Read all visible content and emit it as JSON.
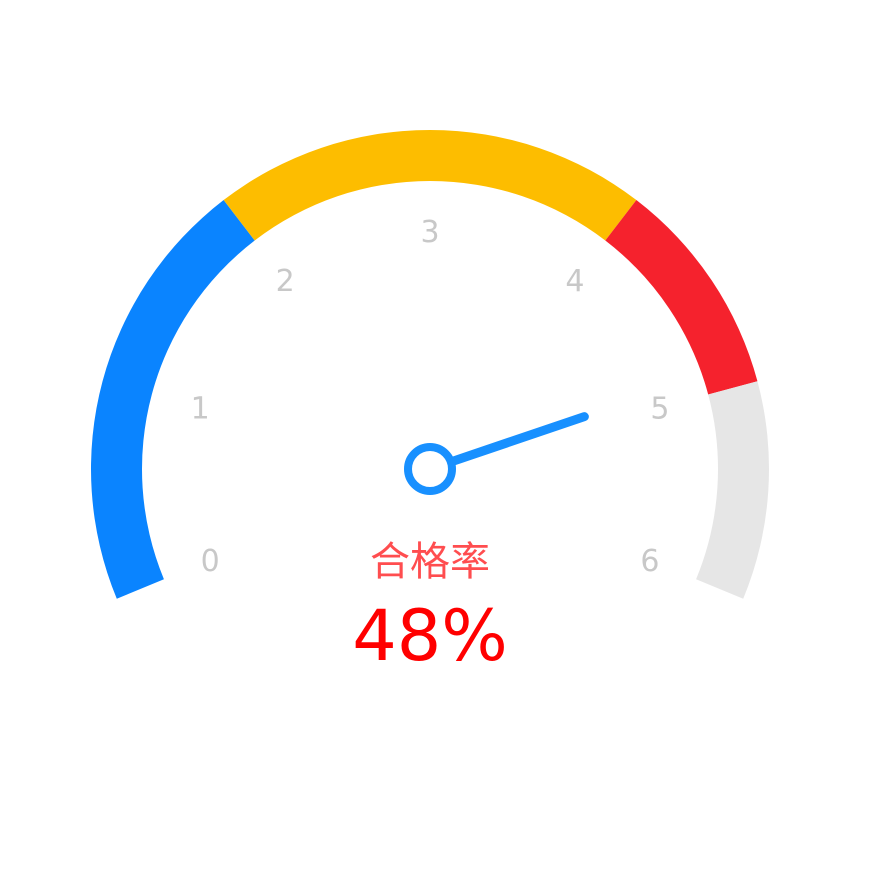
{
  "chart_data": {
    "type": "gauge",
    "title": "合格率",
    "value_text": "48%",
    "pointer_value": 4.9,
    "min": 0,
    "max": 6,
    "ticks": [
      "0",
      "1",
      "2",
      "3",
      "4",
      "5",
      "6"
    ],
    "bands": [
      {
        "from": 0,
        "to": 2,
        "color": "#0a84ff"
      },
      {
        "from": 2,
        "to": 4,
        "color": "#fdbd00"
      },
      {
        "from": 4,
        "to": 5,
        "color": "#f5222d"
      },
      {
        "from": 5,
        "to": 6,
        "color": "#e6e6e6"
      }
    ],
    "colors": {
      "pointer": "#1890ff",
      "title": "#ff4d4f",
      "value": "#ff0000",
      "tick_label": "#c8c8c8"
    }
  }
}
